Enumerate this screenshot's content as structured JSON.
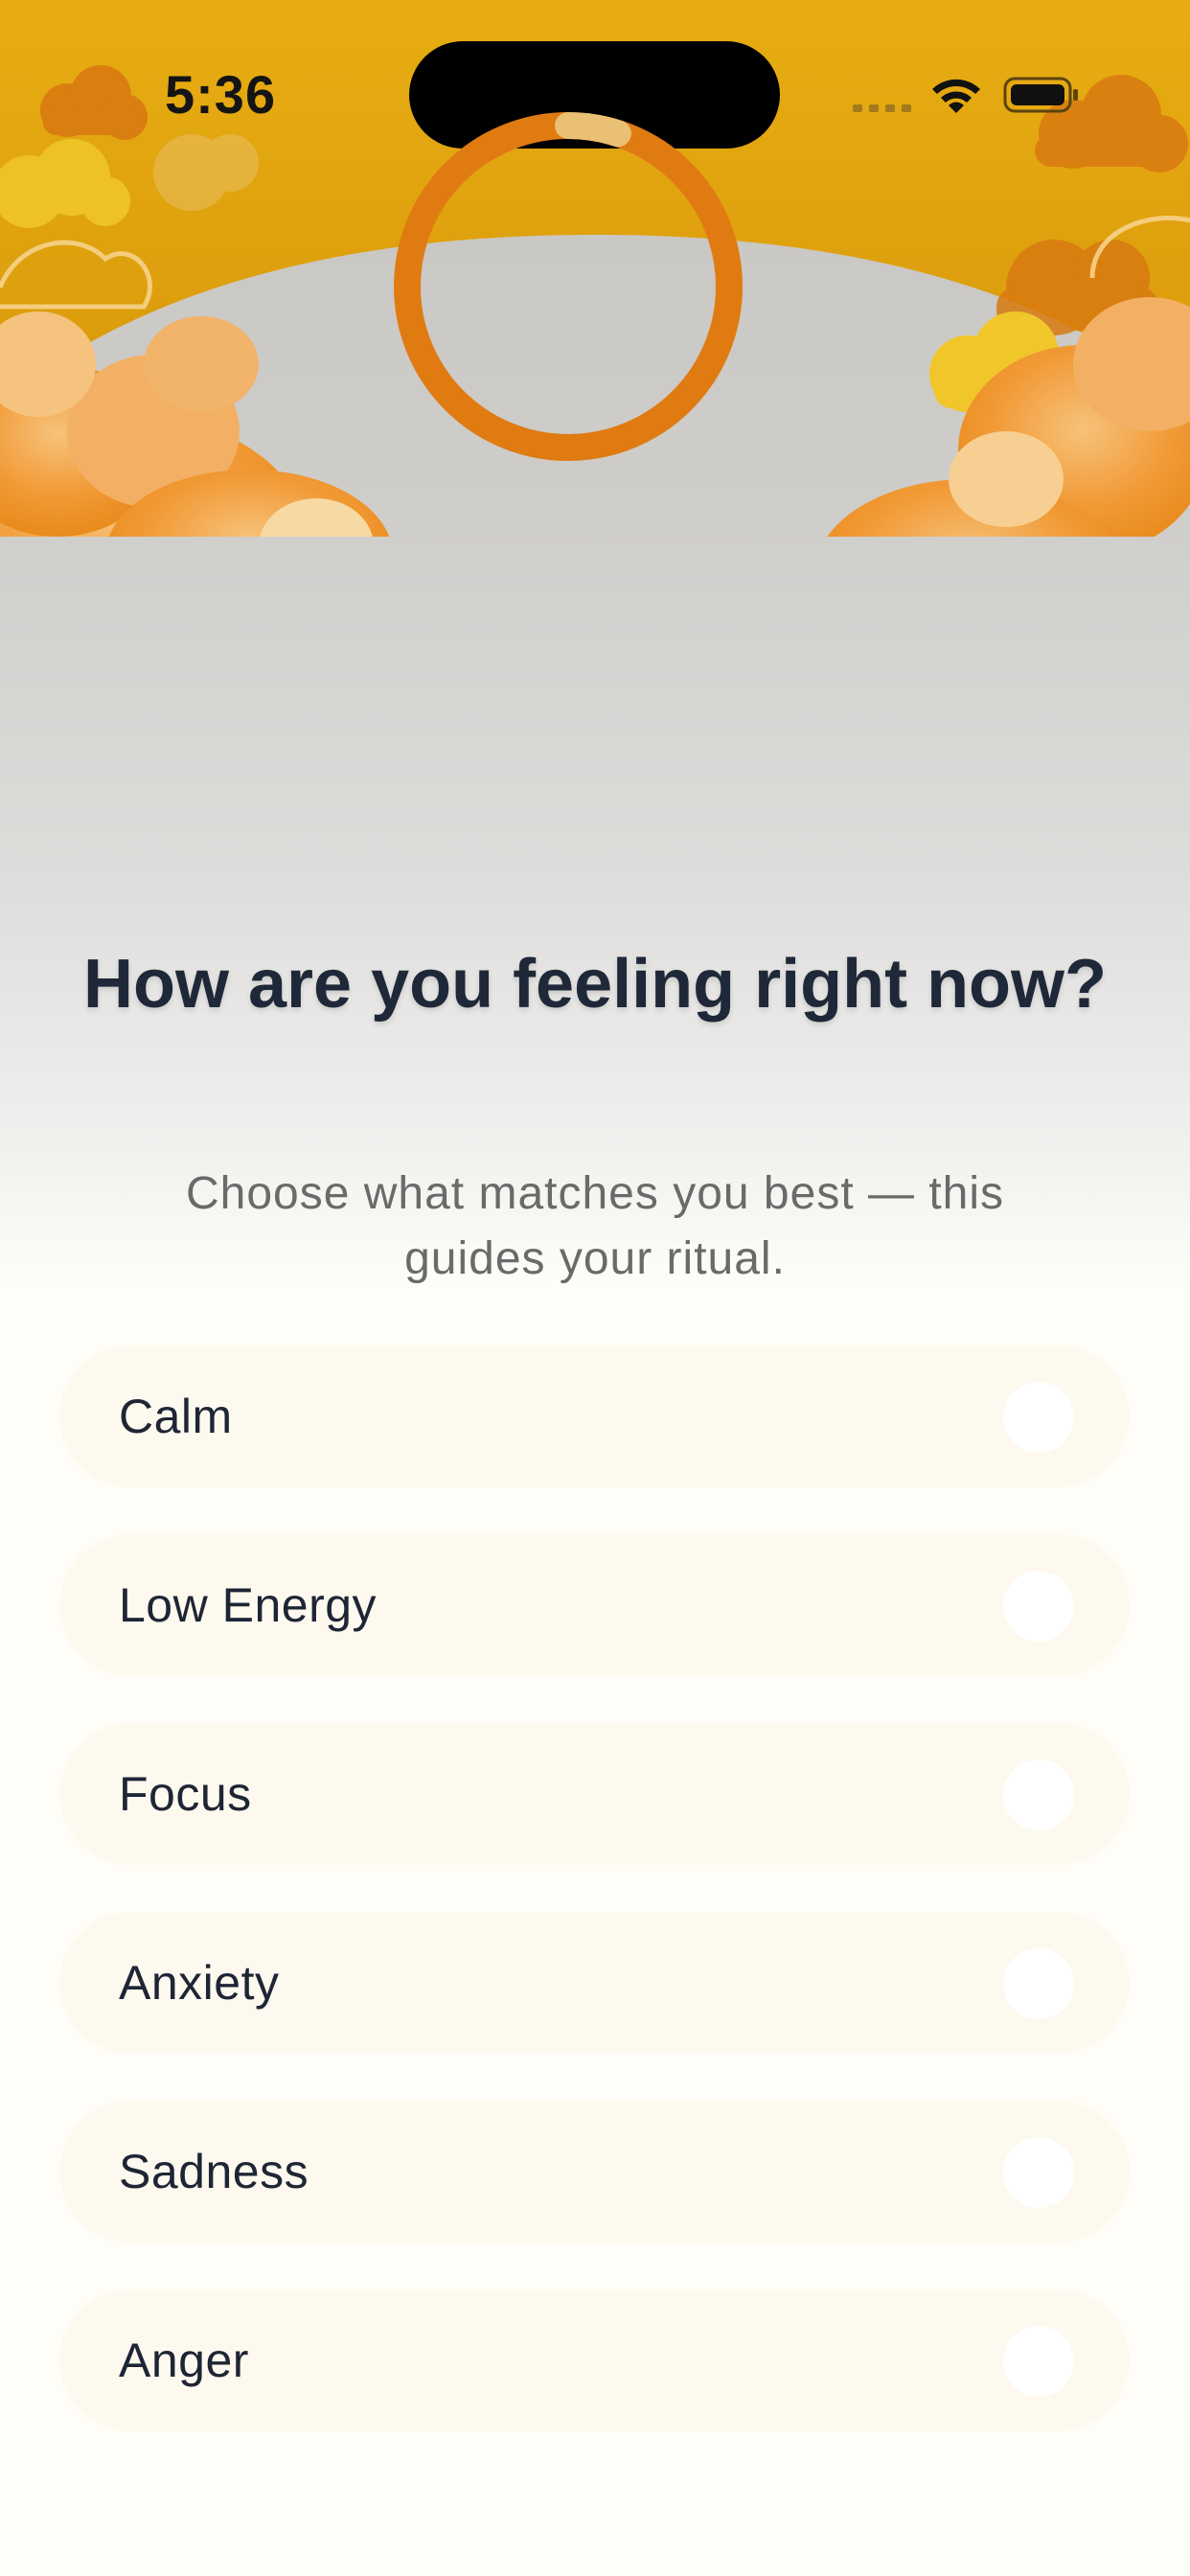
{
  "status_bar": {
    "time": "5:36",
    "icons": [
      "signal-icon",
      "wifi-icon",
      "battery-icon"
    ]
  },
  "progress": {
    "value": 0.05,
    "track_color": "#e07b12",
    "fill_color": "#e9c074"
  },
  "header": {
    "title": "How are you feeling right now?",
    "subtitle": "Choose what matches you best — this guides your ritual."
  },
  "options": [
    {
      "label": "Calm",
      "selected": false
    },
    {
      "label": "Low Energy",
      "selected": false
    },
    {
      "label": "Focus",
      "selected": false
    },
    {
      "label": "Anxiety",
      "selected": false
    },
    {
      "label": "Sadness",
      "selected": false
    },
    {
      "label": "Anger",
      "selected": false
    }
  ],
  "colors": {
    "sky": "#e6a80f",
    "cloud_orange": "#ef8e1e",
    "cloud_yellow": "#f4d26a",
    "text_dark": "#1f2838",
    "text_muted": "#6a6a6a",
    "option_bg": "#fef9ee",
    "page_bg": "#fffdf8"
  }
}
